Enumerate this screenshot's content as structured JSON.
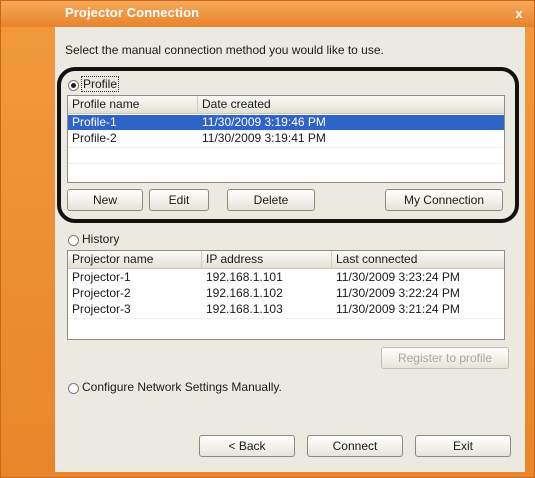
{
  "window": {
    "title": "Projector Connection",
    "close_glyph": "x"
  },
  "prompt": "Select the manual connection method you would like to use.",
  "profile_section": {
    "radio_label": "Profile",
    "selected": true,
    "columns": [
      "Profile name",
      "Date created"
    ],
    "rows": [
      {
        "name": "Profile-1",
        "date": "11/30/2009 3:19:46 PM",
        "selected": true
      },
      {
        "name": "Profile-2",
        "date": "11/30/2009 3:19:41 PM",
        "selected": false
      }
    ],
    "buttons": {
      "new": "New",
      "edit": "Edit",
      "delete": "Delete",
      "my_connection": "My Connection"
    }
  },
  "history_section": {
    "radio_label": "History",
    "selected": false,
    "columns": [
      "Projector name",
      "IP address",
      "Last connected"
    ],
    "rows": [
      {
        "name": "Projector-1",
        "ip": "192.168.1.101",
        "last": "11/30/2009 3:23:24 PM"
      },
      {
        "name": "Projector-2",
        "ip": "192.168.1.102",
        "last": "11/30/2009 3:22:24 PM"
      },
      {
        "name": "Projector-3",
        "ip": "192.168.1.103",
        "last": "11/30/2009 3:21:24 PM"
      }
    ],
    "register_button": "Register to profile"
  },
  "manual_option": {
    "radio_label": "Configure Network Settings Manually.",
    "selected": false
  },
  "footer": {
    "back": "< Back",
    "connect": "Connect",
    "exit": "Exit"
  },
  "colors": {
    "title_orange": "#e8832c",
    "selection_blue": "#2f63c8",
    "dialog_bg": "#eceae0"
  }
}
